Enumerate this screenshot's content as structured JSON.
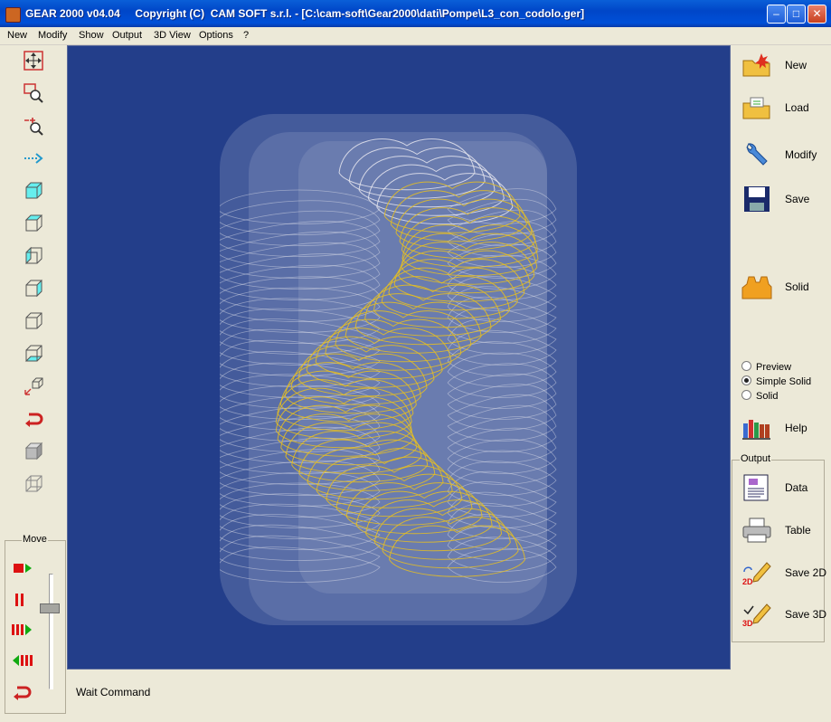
{
  "window": {
    "title": "GEAR 2000 v04.04     Copyright (C)  CAM SOFT s.r.l. - [C:\\cam-soft\\Gear2000\\dati\\Pompe\\L3_con_codolo.ger]",
    "minimize": "–",
    "maximize": "□",
    "close": "✕"
  },
  "menu": [
    "New",
    "Modify",
    "Show",
    "Output",
    "3D View",
    "Options",
    "?"
  ],
  "left_toolbar": {
    "icons": [
      "move-view-icon",
      "zoom-window-icon",
      "zoom-in-out-icon",
      "pan-arrow-icon",
      "view-front-icon",
      "view-top-icon",
      "view-left-icon",
      "view-right-icon",
      "view-back-icon",
      "view-bottom-icon",
      "view-isometric-icon",
      "undo-view-icon",
      "shaded-cube-icon",
      "wireframe-cube-icon"
    ],
    "move_group_label": "Move",
    "move_icons": [
      "play-icon",
      "pause-icon",
      "forward-icon",
      "rewind-icon",
      "return-icon"
    ],
    "slider_level": 0.3
  },
  "right_panel": {
    "buttons": [
      {
        "label": "New",
        "icon": "new-folder-icon"
      },
      {
        "label": "Load",
        "icon": "load-folder-icon"
      },
      {
        "label": "Modify",
        "icon": "wrench-icon"
      },
      {
        "label": "Save",
        "icon": "floppy-disk-icon"
      },
      {
        "label": "Solid",
        "icon": "gear-solid-icon"
      }
    ],
    "render_modes": [
      {
        "label": "Preview",
        "selected": false
      },
      {
        "label": "Simple Solid",
        "selected": true
      },
      {
        "label": "Solid",
        "selected": false
      }
    ],
    "help": {
      "label": "Help",
      "icon": "books-icon"
    },
    "output_group": {
      "label": "Output",
      "buttons": [
        {
          "label": "Data",
          "icon": "document-icon"
        },
        {
          "label": "Table",
          "icon": "printer-icon"
        },
        {
          "label": "Save 2D",
          "icon": "pencil-2d-icon"
        },
        {
          "label": "Save 3D",
          "icon": "pencil-3d-icon"
        }
      ]
    }
  },
  "status": {
    "text": "Wait Command"
  },
  "colors": {
    "viewport_bg": "#233e8a",
    "gear_yellow": "#e8c020",
    "gear_white": "#e8e8f0"
  }
}
